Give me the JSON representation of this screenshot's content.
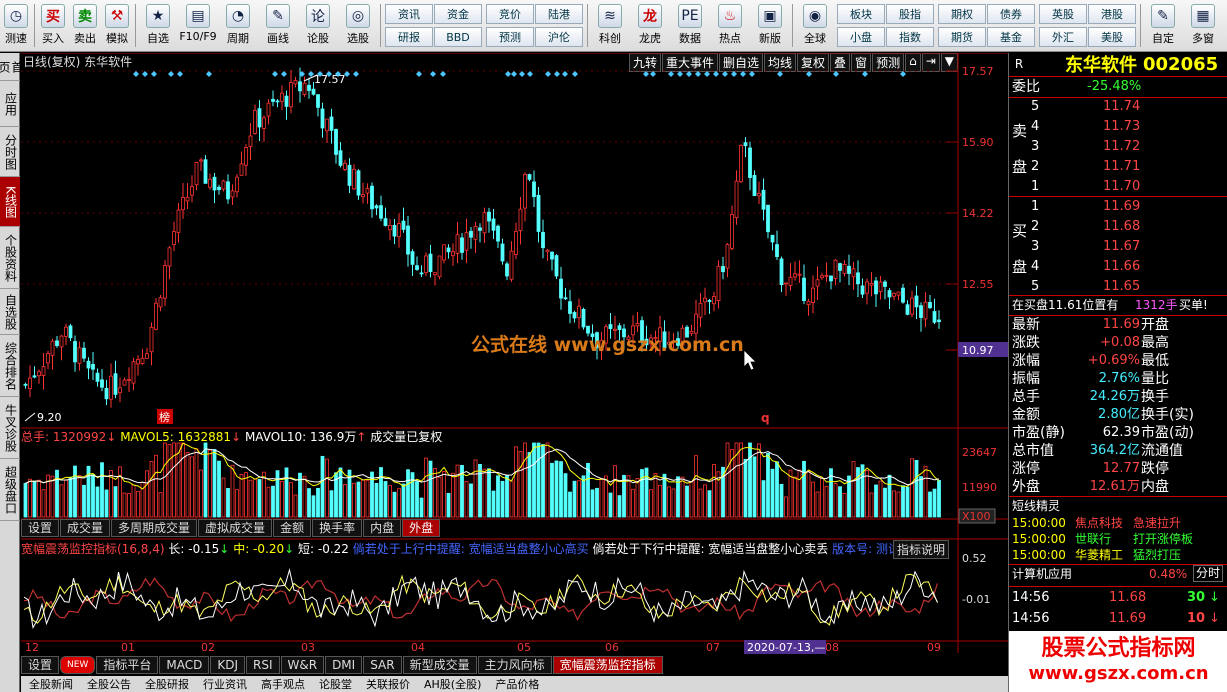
{
  "toolbar": {
    "buttons": [
      {
        "label": "测速",
        "icon": "clock-icon",
        "glyph": "◷"
      },
      {
        "label": "买入",
        "icon": "buy-icon",
        "glyph": "买"
      },
      {
        "label": "卖出",
        "icon": "sell-icon",
        "glyph": "卖"
      },
      {
        "label": "模拟",
        "icon": "hammer-icon",
        "glyph": "⚒"
      },
      {
        "label": "自选",
        "icon": "star-icon",
        "glyph": "★"
      },
      {
        "label": "F10/F9",
        "icon": "f10-icon",
        "glyph": "▤"
      },
      {
        "label": "周期",
        "icon": "clock-icon",
        "glyph": "◔"
      },
      {
        "label": "画线",
        "icon": "pencil-icon",
        "glyph": "✎"
      },
      {
        "label": "论股",
        "icon": "discuss-icon",
        "glyph": "论"
      },
      {
        "label": "选股",
        "icon": "chart-select-icon",
        "glyph": "◎"
      }
    ],
    "grid1": [
      "资讯",
      "资金",
      "研报",
      "BBD"
    ],
    "grid2": [
      "竞价",
      "陆港",
      "预测",
      "沪伦"
    ],
    "buttons2": [
      {
        "label": "科创",
        "icon": "kechuang-icon",
        "glyph": "≋"
      },
      {
        "label": "龙虎",
        "icon": "dragon-icon",
        "glyph": "龙"
      },
      {
        "label": "数据",
        "icon": "pe-icon",
        "glyph": "PE"
      },
      {
        "label": "热点",
        "icon": "fire-icon",
        "glyph": "♨"
      },
      {
        "label": "新版",
        "icon": "new-version-icon",
        "glyph": "▣"
      },
      {
        "label": "全球",
        "icon": "globe-icon",
        "glyph": "◉"
      }
    ],
    "grid3": [
      "板块",
      "股指",
      "小盘",
      "指数"
    ],
    "grid4": [
      "期权",
      "债券",
      "期货",
      "基金"
    ],
    "grid5": [
      "英股",
      "港股",
      "外汇",
      "美股"
    ],
    "buttons3": [
      {
        "label": "自定",
        "icon": "custom-icon",
        "glyph": "✎"
      },
      {
        "label": "多窗",
        "icon": "multi-window-icon",
        "glyph": "▦"
      }
    ]
  },
  "sidebar": [
    "首页",
    "应用",
    "分时图",
    "K线图",
    "个股资料",
    "自选股",
    "综合排名",
    "牛叉诊股",
    "超级盘口"
  ],
  "sidebar_active": 3,
  "chart": {
    "title": "日线(复权) 东华软件",
    "tools": [
      "九转",
      "重大事件",
      "删自选",
      "均线",
      "复权",
      "叠",
      "窗",
      "预测",
      "⌂",
      "⇥",
      "▼"
    ],
    "y_ticks": [
      "17.57",
      "15.90",
      "14.22",
      "12.55",
      "10.97"
    ],
    "current_price_tag": "10.97",
    "max_label": "17.57",
    "min_label": "9.20",
    "bang_label": "榜",
    "q_label": "q",
    "watermark": "公式在线 www.gszx.com.cn",
    "up_color": "#ff3232",
    "down_color": "#54ffff"
  },
  "volume": {
    "header_total": "总手: 1320992",
    "header_ma5": "MAVOL5: 1632881",
    "header_ma10": "MAVOL10: 136.9万",
    "header_note": "成交量已复权",
    "y_ticks": [
      "23647",
      "11990",
      "X100"
    ],
    "tabs": [
      "设置",
      "成交量",
      "多周期成交量",
      "虚拟成交量",
      "金额",
      "换手率",
      "内盘",
      "外盘"
    ],
    "active_tab": 7
  },
  "indicator": {
    "name": "宽幅震荡监控指标(16,8,4)",
    "long": "长: -0.15",
    "mid": "中: -0.20",
    "short": "短: -0.22",
    "note1": "倘若处于上行中提醒: 宽幅适当盘整小心高买",
    "note2": "倘若处于下行中提醒: 宽幅适当盘整小心卖丢",
    "version": "版本号: 测试版",
    "explain": "指标说明",
    "y_ticks": [
      "0.52",
      "-0.01"
    ]
  },
  "x_axis": {
    "months": [
      "12",
      "01",
      "02",
      "03",
      "04",
      "05",
      "06",
      "07",
      "08",
      "09"
    ],
    "date_tag": "2020-07-13,—"
  },
  "bottom_tabs": [
    "设置",
    "NEW",
    "指标平台",
    "MACD",
    "KDJ",
    "RSI",
    "W&R",
    "DMI",
    "SAR",
    "新型成交量",
    "主力风向标",
    "宽幅震荡监控指标"
  ],
  "bottom_active": 11,
  "bottom_strip": [
    "全股新闻",
    "全股公告",
    "全股研报",
    "行业资讯",
    "高手观点",
    "论股堂",
    "关联报价",
    "AH股(全股)",
    "产品价格"
  ],
  "right_panel": {
    "code_letter": "R",
    "name": "东华软件",
    "code": "002065",
    "weibi_label": "委比",
    "weibi_value": "-25.48%",
    "sell_label_top": "卖",
    "sell_label_bottom": "盘",
    "buy_label_top": "买",
    "buy_label_bottom": "盘",
    "sell": [
      {
        "level": "5",
        "price": "11.74"
      },
      {
        "level": "4",
        "price": "11.73"
      },
      {
        "level": "3",
        "price": "11.72"
      },
      {
        "level": "2",
        "price": "11.71"
      },
      {
        "level": "1",
        "price": "11.70"
      }
    ],
    "buy": [
      {
        "level": "1",
        "price": "11.69"
      },
      {
        "level": "2",
        "price": "11.68"
      },
      {
        "level": "3",
        "price": "11.67"
      },
      {
        "level": "4",
        "price": "11.66"
      },
      {
        "level": "5",
        "price": "11.65"
      }
    ],
    "notice_prefix": "在买盘11.61位置有",
    "notice_qty": "1312手",
    "notice_suffix": "买单!",
    "stats": [
      {
        "l1": "最新",
        "v1": "11.69",
        "c1": "red",
        "l2": "开盘",
        "v2": ""
      },
      {
        "l1": "涨跌",
        "v1": "+0.08",
        "c1": "red",
        "l2": "最高",
        "v2": ""
      },
      {
        "l1": "涨幅",
        "v1": "+0.69%",
        "c1": "red",
        "l2": "最低",
        "v2": ""
      },
      {
        "l1": "振幅",
        "v1": "2.76%",
        "c1": "cy",
        "l2": "量比",
        "v2": ""
      },
      {
        "l1": "总手",
        "v1": "24.26万",
        "c1": "cy",
        "l2": "换手",
        "v2": ""
      },
      {
        "l1": "金额",
        "v1": "2.80亿",
        "c1": "cy",
        "l2": "换手(实)",
        "v2": ""
      },
      {
        "l1": "市盈(静)",
        "v1": "62.39",
        "c1": "wht",
        "l2": "市盈(动)",
        "v2": ""
      },
      {
        "l1": "总市值",
        "v1": "364.2亿",
        "c1": "cy",
        "l2": "流通值",
        "v2": ""
      },
      {
        "l1": "涨停",
        "v1": "12.77",
        "c1": "red",
        "l2": "跌停",
        "v2": ""
      },
      {
        "l1": "外盘",
        "v1": "12.61万",
        "c1": "red",
        "l2": "内盘",
        "v2": ""
      }
    ],
    "sprite_title": "短线精灵",
    "sprites": [
      {
        "time": "15:00:00",
        "name": "焦点科技",
        "event": "急速拉升",
        "nc": "red",
        "ec": "red"
      },
      {
        "time": "15:00:00",
        "name": "世联行",
        "event": "打开涨停板",
        "nc": "grn",
        "ec": "grn"
      },
      {
        "time": "15:00:00",
        "name": "华菱精工",
        "event": "猛烈打压",
        "nc": "yel",
        "ec": "grn"
      }
    ],
    "app_title": "计算机应用",
    "app_change": "0.48%",
    "app_tab": "分时",
    "ticks": [
      {
        "time": "14:56",
        "price": "11.68",
        "qty": "30",
        "dir": "down"
      },
      {
        "time": "14:56",
        "price": "11.69",
        "qty": "10",
        "dir": "down"
      }
    ],
    "brand_main": "股票公式指标网",
    "brand_url": "www.gszx.com.cn"
  }
}
